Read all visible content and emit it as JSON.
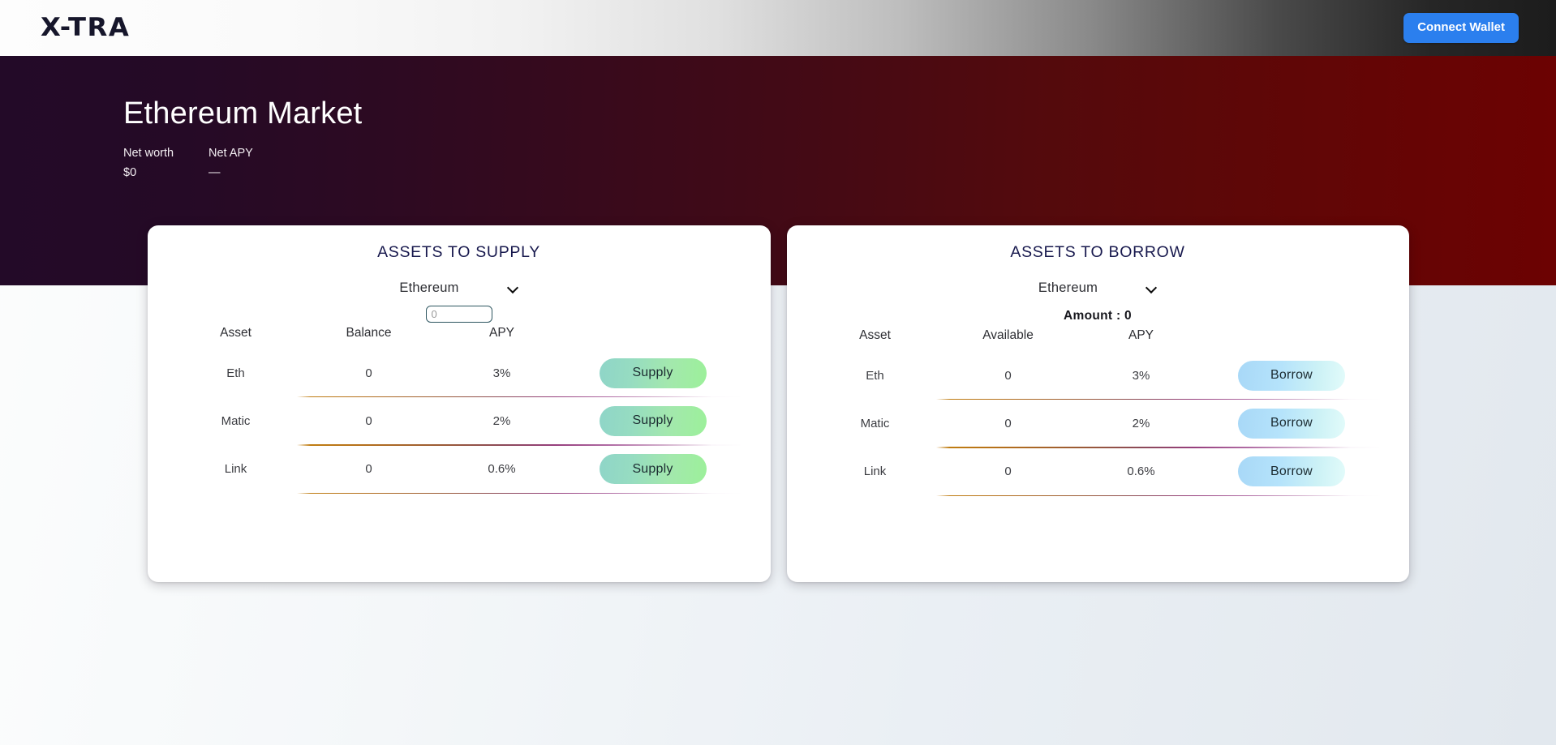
{
  "header": {
    "logo": "X-TRA",
    "connect_wallet_label": "Connect Wallet",
    "accent_color": "#2b7fee"
  },
  "hero": {
    "title": "Ethereum Market",
    "stats": [
      {
        "label": "Net worth",
        "value": "$0"
      },
      {
        "label": "Net APY",
        "value": "—"
      }
    ],
    "gradient_from": "#230a28",
    "gradient_to": "#6c0202"
  },
  "supply_card": {
    "title": "ASSETS TO SUPPLY",
    "network_select": {
      "value": "Ethereum",
      "icon": "chevron-down-icon"
    },
    "amount_input": {
      "value": "",
      "placeholder": "0"
    },
    "columns": [
      "Asset",
      "Balance",
      "APY"
    ],
    "action_label": "Supply",
    "rows": [
      {
        "asset": "Eth",
        "balance": "0",
        "apy": "3%",
        "action": "Supply"
      },
      {
        "asset": "Matic",
        "balance": "0",
        "apy": "2%",
        "action": "Supply"
      },
      {
        "asset": "Link",
        "balance": "0",
        "apy": "0.6%",
        "action": "Supply"
      }
    ],
    "button_gradient_from": "#8fd5c8",
    "button_gradient_to": "#9cf09a"
  },
  "borrow_card": {
    "title": "ASSETS TO BORROW",
    "network_select": {
      "value": "Ethereum",
      "icon": "chevron-down-icon"
    },
    "amount_text": "Amount : 0",
    "columns": [
      "Asset",
      "Available",
      "APY"
    ],
    "action_label": "Borrow",
    "rows": [
      {
        "asset": "Eth",
        "available": "0",
        "apy": "3%",
        "action": "Borrow"
      },
      {
        "asset": "Matic",
        "available": "0",
        "apy": "2%",
        "action": "Borrow"
      },
      {
        "asset": "Link",
        "available": "0",
        "apy": "0.6%",
        "action": "Borrow"
      }
    ],
    "button_gradient_from": "#a8d8f7",
    "button_gradient_to": "#e2fbfa"
  }
}
